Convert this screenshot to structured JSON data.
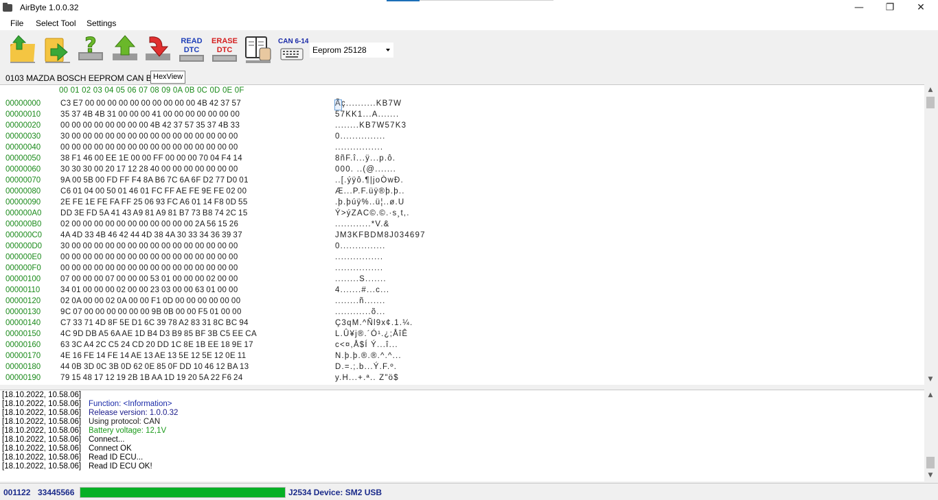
{
  "window": {
    "title": "AirByte  1.0.0.32",
    "minimize_glyph": "—",
    "restore_glyph": "❐",
    "close_glyph": "✕"
  },
  "menu": {
    "items": [
      "File",
      "Select Tool",
      "Settings"
    ]
  },
  "toolbar": {
    "read_dtc_line1": "READ",
    "read_dtc_line2": "DTC",
    "erase_dtc_line1": "ERASE",
    "erase_dtc_line2": "DTC",
    "can_label": "CAN 6-14",
    "eeprom_select": "Eeprom 25128",
    "colors": {
      "read_dtc": "#1e3fb8",
      "erase_dtc": "#d42020"
    }
  },
  "info": {
    "ecu_label": "0103 MAZDA BOSCH EEPROM CAN BUS",
    "hexview_tab": "HexView"
  },
  "hex": {
    "header": "00 01 02 03 04 05 06 07 08 09 0A 0B 0C 0D 0E 0F",
    "rows": [
      {
        "addr": "00000000",
        "bytes": "C3 E7 00 00 00 00 00 00 00 00 00 00 4B 42 37 57",
        "ascii": "Ãç..........KB7W"
      },
      {
        "addr": "00000010",
        "bytes": "35 37 4B 4B 31 00 00 00 41 00 00 00 00 00 00 00",
        "ascii": "57KK1...A......."
      },
      {
        "addr": "00000020",
        "bytes": "00 00 00 00 00 00 00 00 4B 42 37 57 35 37 4B 33",
        "ascii": "........KB7W57K3"
      },
      {
        "addr": "00000030",
        "bytes": "30 00 00 00 00 00 00 00 00 00 00 00 00 00 00 00",
        "ascii": "0..............."
      },
      {
        "addr": "00000040",
        "bytes": "00 00 00 00 00 00 00 00 00 00 00 00 00 00 00 00",
        "ascii": "................"
      },
      {
        "addr": "00000050",
        "bytes": "38 F1 46 00 EE 1E 00 00 FF 00 00 00 70 04 F4 14",
        "ascii": "8ñF.î...ÿ...p.ô."
      },
      {
        "addr": "00000060",
        "bytes": "30 30 30 00 20 17 12 28 40 00 00 00 00 00 00 00",
        "ascii": "000. ..(@......."
      },
      {
        "addr": "00000070",
        "bytes": "9A 00 5B 00 FD FF F4 8A B6 7C 6A 6F D2 77 D0 01",
        "ascii": "..[.ýÿô.¶|joÒwÐ."
      },
      {
        "addr": "00000080",
        "bytes": "C6 01 04 00 50 01 46 01 FC FF AE FE 9E FE 02 00",
        "ascii": "Æ...P.F.üÿ®þ.þ.."
      },
      {
        "addr": "00000090",
        "bytes": "2E FE 1E FE FA FF 25 06 93 FC A6 01 14 F8 0D 55",
        "ascii": ".þ.þúÿ%..ü¦..ø.U"
      },
      {
        "addr": "000000A0",
        "bytes": "DD 3E FD 5A 41 43 A9 81 A9 81 B7 73 B8 74 2C 15",
        "ascii": "Ý>ýZAC©.©.·s¸t,."
      },
      {
        "addr": "000000B0",
        "bytes": "02 00 00 00 00 00 00 00 00 00 00 00 2A 56 15 26",
        "ascii": "............*V.&"
      },
      {
        "addr": "000000C0",
        "bytes": "4A 4D 33 4B 46 42 44 4D 38 4A 30 33 34 36 39 37",
        "ascii": "JM3KFBDM8J034697"
      },
      {
        "addr": "000000D0",
        "bytes": "30 00 00 00 00 00 00 00 00 00 00 00 00 00 00 00",
        "ascii": "0..............."
      },
      {
        "addr": "000000E0",
        "bytes": "00 00 00 00 00 00 00 00 00 00 00 00 00 00 00 00",
        "ascii": "................"
      },
      {
        "addr": "000000F0",
        "bytes": "00 00 00 00 00 00 00 00 00 00 00 00 00 00 00 00",
        "ascii": "................"
      },
      {
        "addr": "00000100",
        "bytes": "07 00 00 00 07 00 00 00 53 01 00 00 00 02 00 00",
        "ascii": "........S......."
      },
      {
        "addr": "00000110",
        "bytes": "34 01 00 00 00 02 00 00 23 03 00 00 63 01 00 00",
        "ascii": "4.......#...c..."
      },
      {
        "addr": "00000120",
        "bytes": "02 0A 00 00 02 0A 00 00 F1 0D 00 00 00 00 00 00",
        "ascii": "........ñ......."
      },
      {
        "addr": "00000130",
        "bytes": "9C 07 00 00 00 00 00 00 9B 0B 00 00 F5 01 00 00",
        "ascii": "............õ..."
      },
      {
        "addr": "00000140",
        "bytes": "C7 33 71 4D 8F 5E D1 6C 39 78 A2 83 31 8C BC 94",
        "ascii": "Ç3qM.^Ñl9x¢.1.¼."
      },
      {
        "addr": "00000150",
        "bytes": "4C 9D DB A5 6A AE 1D B4 D3 B9 85 BF 3B C5 EE CA",
        "ascii": "L.Û¥j®.´Ó¹.¿;ÅîÊ"
      },
      {
        "addr": "00000160",
        "bytes": "63 3C A4 2C C5 24 CD 20 DD 1C 8E 1B EE 18 9E 17",
        "ascii": "c<¤,Å$Í Ý...î..."
      },
      {
        "addr": "00000170",
        "bytes": "4E 16 FE 14 FE 14 AE 13 AE 13 5E 12 5E 12 0E 11",
        "ascii": "N.þ.þ.®.®.^.^..."
      },
      {
        "addr": "00000180",
        "bytes": "44 0B 3D 0C 3B 0D 62 0E 85 0F DD 10 46 12 BA 13",
        "ascii": "D.=.;.b...Ý.F.º."
      },
      {
        "addr": "00000190",
        "bytes": "79 15 48 17 12 19 2B 1B AA 1D 19 20 5A 22 F6 24",
        "ascii": "y.H...+.ª.. Z\"ö$"
      }
    ]
  },
  "log": {
    "entries": [
      {
        "ts": "[18.10.2022, 10.58.06]",
        "msg": "",
        "color": "#000000"
      },
      {
        "ts": "[18.10.2022, 10.58.06]",
        "msg": "Function: <Information>",
        "color": "#1a2aa8"
      },
      {
        "ts": "[18.10.2022, 10.58.06]",
        "msg": "Release version: 1.0.0.32",
        "color": "#1a1a8a"
      },
      {
        "ts": "[18.10.2022, 10.58.06]",
        "msg": "Using protocol: CAN",
        "color": "#1a1a1a"
      },
      {
        "ts": "[18.10.2022, 10.58.06]",
        "msg": "Battery voltage: 12,1V",
        "color": "#1a9a1a"
      },
      {
        "ts": "[18.10.2022, 10.58.06]",
        "msg": "Connect...",
        "color": "#000000"
      },
      {
        "ts": "[18.10.2022, 10.58.06]",
        "msg": "Connect OK",
        "color": "#000000"
      },
      {
        "ts": "[18.10.2022, 10.58.06]",
        "msg": "Read ID ECU...",
        "color": "#000000"
      },
      {
        "ts": "[18.10.2022, 10.58.06]",
        "msg": "Read ID ECU OK!",
        "color": "#000000"
      }
    ]
  },
  "status": {
    "id": "001122",
    "number": "33445566",
    "progress_percent": 100,
    "device": "J2534 Device: SM2 USB"
  }
}
